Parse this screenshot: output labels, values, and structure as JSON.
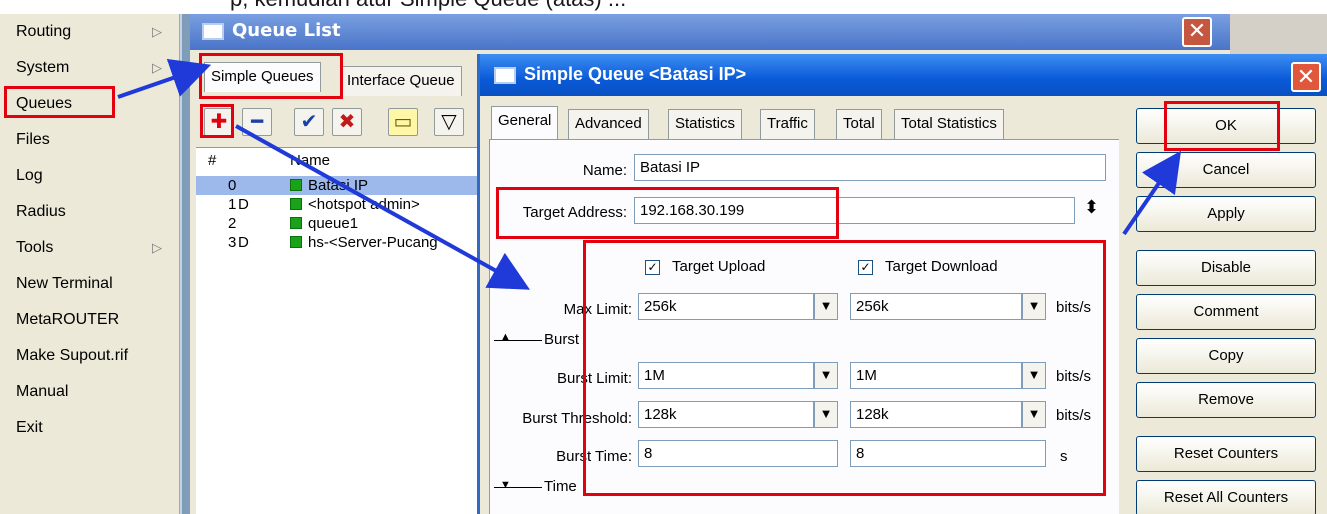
{
  "caption": "p, kemudian atur Simple Queue (atas) ...",
  "menu": {
    "items": [
      {
        "label": "Routing",
        "has_submenu": true
      },
      {
        "label": "System",
        "has_submenu": true
      },
      {
        "label": "Queues",
        "has_submenu": false
      },
      {
        "label": "Files",
        "has_submenu": false
      },
      {
        "label": "Log",
        "has_submenu": false
      },
      {
        "label": "Radius",
        "has_submenu": false
      },
      {
        "label": "Tools",
        "has_submenu": true
      },
      {
        "label": "New Terminal",
        "has_submenu": false
      },
      {
        "label": "MetaROUTER",
        "has_submenu": false
      },
      {
        "label": "Make Supout.rif",
        "has_submenu": false
      },
      {
        "label": "Manual",
        "has_submenu": false
      },
      {
        "label": "Exit",
        "has_submenu": false
      }
    ],
    "submenu_glyph": "▷"
  },
  "queue_list": {
    "title": "Queue List",
    "close_glyph": "✕",
    "tabs": [
      "Simple Queues",
      "Interface Queue"
    ],
    "toolbar": {
      "add": "✚",
      "remove": "━",
      "enable": "✔",
      "disable": "✖",
      "comment": "▭",
      "filter": "▽"
    },
    "table": {
      "headers": [
        "#",
        "Name"
      ],
      "rows": [
        {
          "num": "0",
          "flag": "",
          "name": "Batasi IP",
          "selected": true
        },
        {
          "num": "1",
          "flag": "D",
          "name": "<hotspot admin>",
          "selected": false
        },
        {
          "num": "2",
          "flag": "",
          "name": "queue1",
          "selected": false
        },
        {
          "num": "3",
          "flag": "D",
          "name": "hs-<Server-Pucang",
          "selected": false
        }
      ]
    }
  },
  "simple_queue": {
    "title": "Simple Queue <Batasi IP>",
    "close_glyph": "✕",
    "tabs": [
      "General",
      "Advanced",
      "Statistics",
      "Traffic",
      "Total",
      "Total Statistics"
    ],
    "active_tab": "General",
    "name_label": "Name:",
    "name_value": "Batasi IP",
    "target_label": "Target Address:",
    "target_value": "192.168.30.199",
    "updown_glyph": "⬍",
    "target_upload_label": "Target Upload",
    "target_download_label": "Target Download",
    "check_glyph": "✓",
    "dropdown_glyph": "▼",
    "max_limit": {
      "label": "Max Limit:",
      "upload": "256k",
      "download": "256k",
      "unit": "bits/s"
    },
    "burst_section": "Burst",
    "burst_collapse_glyph": "▲",
    "burst_limit": {
      "label": "Burst Limit:",
      "upload": "1M",
      "download": "1M",
      "unit": "bits/s"
    },
    "burst_threshold": {
      "label": "Burst Threshold:",
      "upload": "128k",
      "download": "128k",
      "unit": "bits/s"
    },
    "burst_time": {
      "label": "Burst Time:",
      "upload": "8",
      "download": "8",
      "unit": "s"
    },
    "time_section": "Time",
    "time_expand_glyph": "▼"
  },
  "buttons": [
    "OK",
    "Cancel",
    "Apply",
    "Disable",
    "Comment",
    "Copy",
    "Remove",
    "Reset Counters",
    "Reset All Counters"
  ],
  "highlight_color": "#e3000f",
  "arrow_color": "#1f3ad8"
}
